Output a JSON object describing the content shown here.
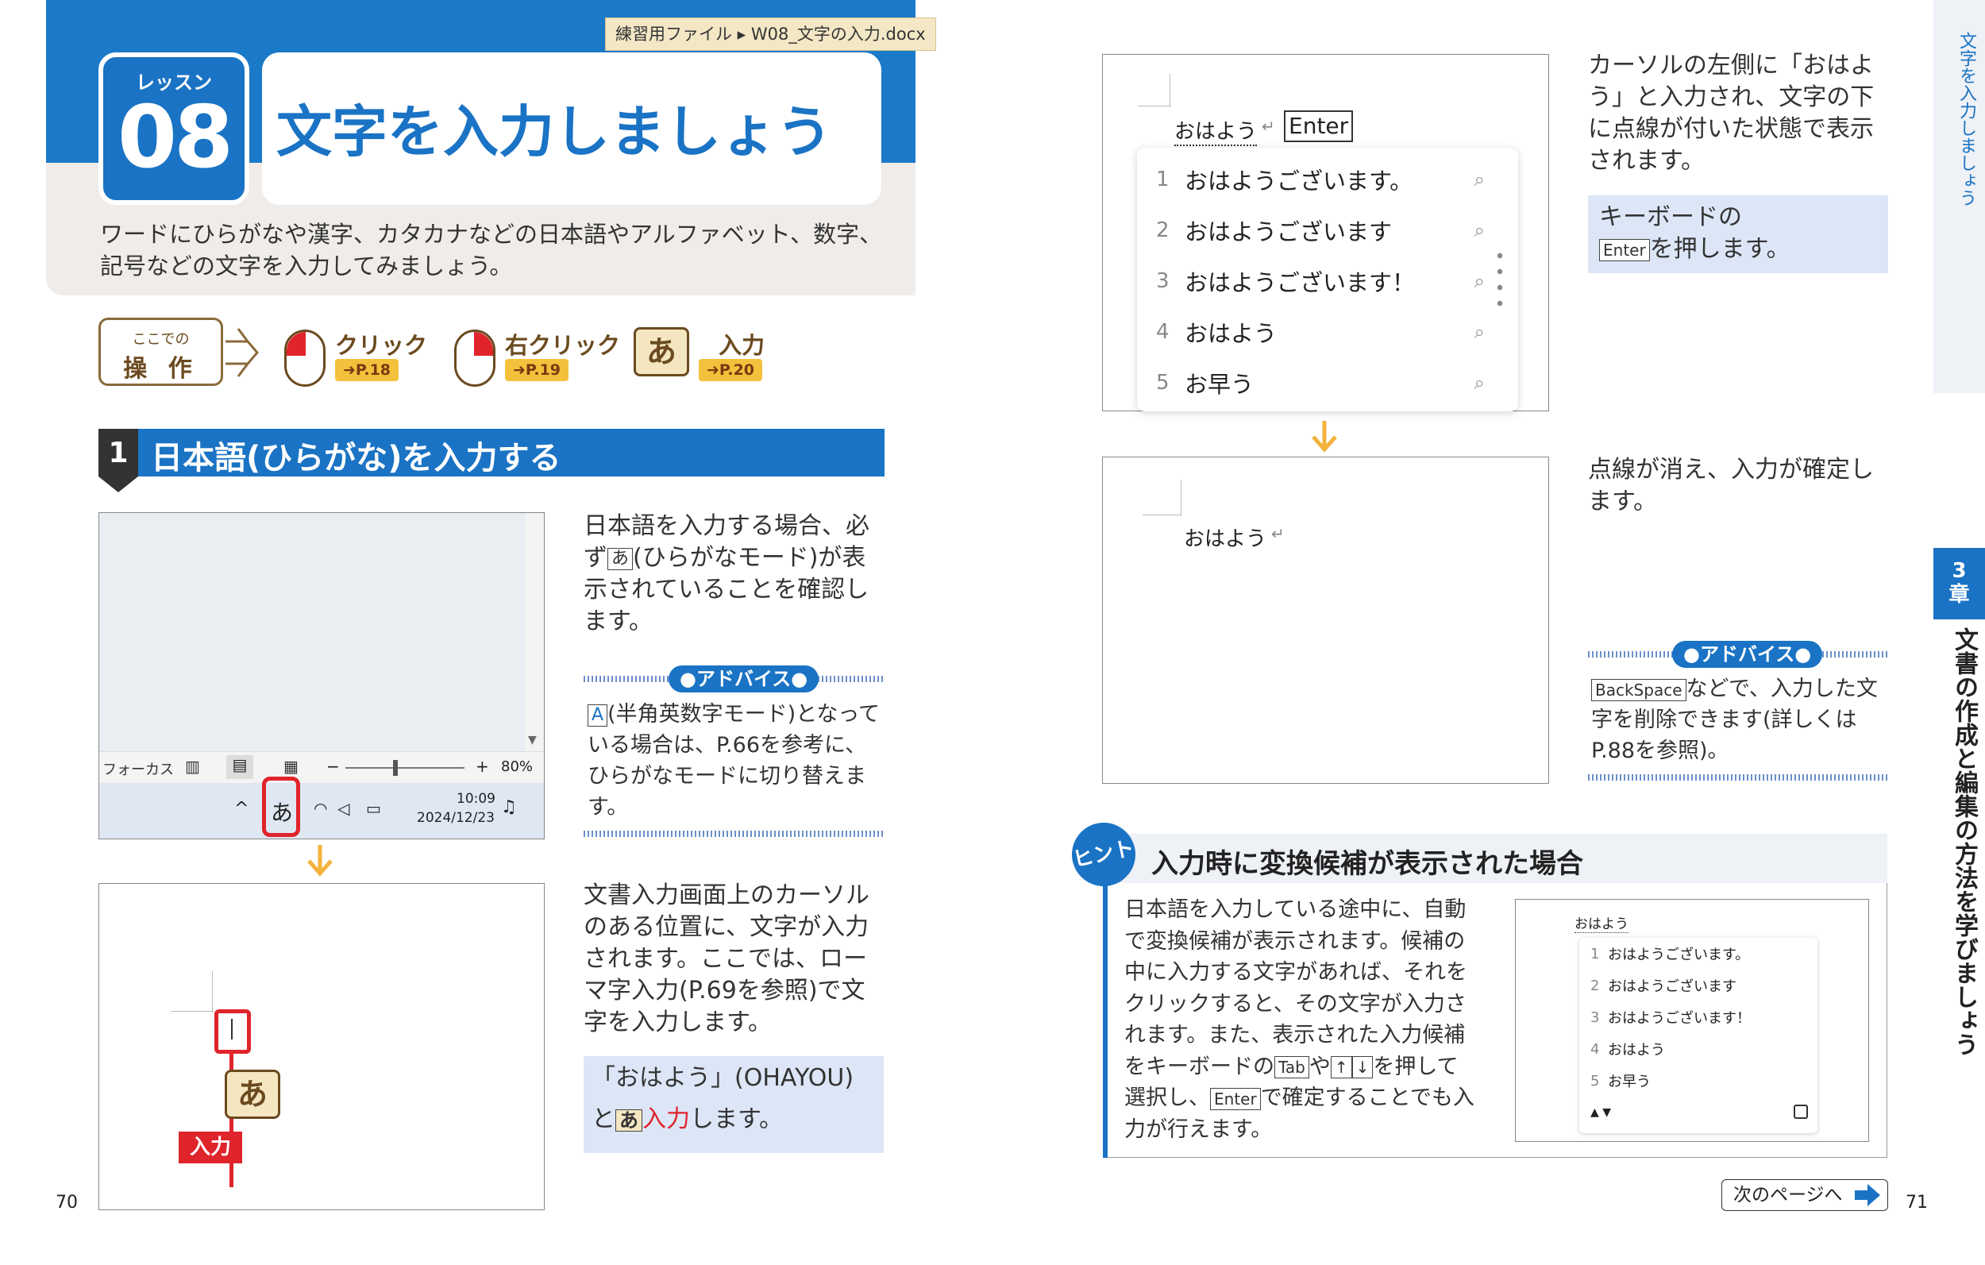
{
  "header": {
    "file_label": "練習用ファイル ▸ W08_文字の入力.docx",
    "lesson_label": "レッスン",
    "lesson_number": "08",
    "title": "文字を入力しましょう",
    "intro_line1": "ワードにひらがなや漢字、カタカナなどの日本語やアルファベット、数字、",
    "intro_line2": "記号などの文字を入力してみましょう。"
  },
  "operations": {
    "box_small": "ここでの",
    "box_big": "操 作",
    "items": [
      {
        "label": "クリック",
        "ref": "➜P.18",
        "icon": "mouse-left-icon"
      },
      {
        "label": "右クリック",
        "ref": "➜P.19",
        "icon": "mouse-right-icon"
      },
      {
        "label": "入力",
        "ref": "➜P.20",
        "icon": "ime-key-icon"
      }
    ],
    "ime_glyph": "あ"
  },
  "section1": {
    "number": "1",
    "title": "日本語(ひらがな)を入力する"
  },
  "step1": {
    "text_parts": [
      "日本語を入力する場合、必ず",
      "あ",
      "(ひらがなモード)が表示されていることを確認します。"
    ],
    "taskbar": {
      "focus": "フォーカス",
      "zoom": "80%",
      "ime": "あ",
      "time": "10:09",
      "date": "2024/12/23",
      "minus": "−",
      "plus": "+"
    }
  },
  "advice1": {
    "tag": "●アドバイス●",
    "key": "A",
    "text": "(半角英数字モード)となっている場合は、P.66を参考に、ひらがなモードに切り替えます。"
  },
  "step2": {
    "text": "文書入力画面上のカーソルのある位置に、文字が入力されます。ここでは、ローマ字入力(P.69を参照)で文字を入力します。",
    "input_label": "入力",
    "ime_glyph": "あ",
    "callout_line1": "「おはよう」(OHAYOU)",
    "callout_pre": "と",
    "callout_key": "あ",
    "callout_em": "入力",
    "callout_post": "します。"
  },
  "step3": {
    "typed": "おはよう",
    "return_mark": "↵",
    "enter_key": "Enter",
    "candidates": [
      {
        "n": "1",
        "text": "おはようございます。"
      },
      {
        "n": "2",
        "text": "おはようございます"
      },
      {
        "n": "3",
        "text": "おはようございます！"
      },
      {
        "n": "4",
        "text": "おはよう"
      },
      {
        "n": "5",
        "text": "お早う"
      }
    ],
    "search_glyph": "⌕",
    "text": "カーソルの左側に「おはよう」と入力され、文字の下に点線が付いた状態で表示されます。",
    "callout_line1": "キーボードの",
    "callout_key": "Enter",
    "callout_post": "を押します。"
  },
  "step4": {
    "typed": "おはよう",
    "return_mark": "↵",
    "text": "点線が消え、入力が確定します。"
  },
  "advice2": {
    "tag": "●アドバイス●",
    "key": "BackSpace",
    "text": "などで、入力した文字を削除できます(詳しくはP.88を参照)。"
  },
  "hint": {
    "badge": "ヒント",
    "title": "入力時に変換候補が表示された場合",
    "text_parts": [
      "日本語を入力している途中に、自動で変換候補が表示されます。候補の中に入力する文字があれば、それをクリックすると、その文字が入力されます。また、表示された入力候補をキーボードの",
      "Tab",
      "や",
      "↑",
      "↓",
      "を押して選択し、",
      "Enter",
      "で確定することでも入力が行えます。"
    ],
    "mini_typed": "おはよう",
    "mini_candidates": [
      {
        "n": "1",
        "text": "おはようございます。"
      },
      {
        "n": "2",
        "text": "おはようございます"
      },
      {
        "n": "3",
        "text": "おはようございます！"
      },
      {
        "n": "4",
        "text": "おはよう"
      },
      {
        "n": "5",
        "text": "お早う"
      }
    ]
  },
  "side": {
    "lesson_tab": "文字を入力しましょう",
    "chapter_num": "3",
    "chapter_char": "章",
    "chapter_title": "文書の作成と編集の方法を学びましょう"
  },
  "footer": {
    "page_left": "70",
    "page_right": "71",
    "next": "次のページへ"
  },
  "colors": {
    "accent": "#1a73c4",
    "red": "#e0242b",
    "gold": "#f3c13c",
    "callout": "#dce6f6"
  }
}
